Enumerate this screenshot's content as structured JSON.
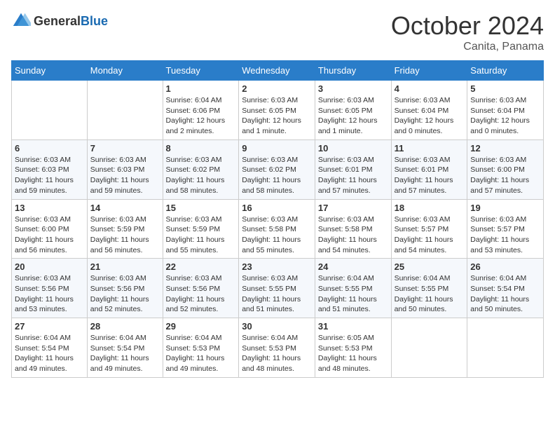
{
  "logo": {
    "text_general": "General",
    "text_blue": "Blue"
  },
  "title": "October 2024",
  "location": "Canita, Panama",
  "days_of_week": [
    "Sunday",
    "Monday",
    "Tuesday",
    "Wednesday",
    "Thursday",
    "Friday",
    "Saturday"
  ],
  "weeks": [
    [
      {
        "day": "",
        "info": ""
      },
      {
        "day": "",
        "info": ""
      },
      {
        "day": "1",
        "info": "Sunrise: 6:04 AM\nSunset: 6:06 PM\nDaylight: 12 hours\nand 2 minutes."
      },
      {
        "day": "2",
        "info": "Sunrise: 6:03 AM\nSunset: 6:05 PM\nDaylight: 12 hours\nand 1 minute."
      },
      {
        "day": "3",
        "info": "Sunrise: 6:03 AM\nSunset: 6:05 PM\nDaylight: 12 hours\nand 1 minute."
      },
      {
        "day": "4",
        "info": "Sunrise: 6:03 AM\nSunset: 6:04 PM\nDaylight: 12 hours\nand 0 minutes."
      },
      {
        "day": "5",
        "info": "Sunrise: 6:03 AM\nSunset: 6:04 PM\nDaylight: 12 hours\nand 0 minutes."
      }
    ],
    [
      {
        "day": "6",
        "info": "Sunrise: 6:03 AM\nSunset: 6:03 PM\nDaylight: 11 hours\nand 59 minutes."
      },
      {
        "day": "7",
        "info": "Sunrise: 6:03 AM\nSunset: 6:03 PM\nDaylight: 11 hours\nand 59 minutes."
      },
      {
        "day": "8",
        "info": "Sunrise: 6:03 AM\nSunset: 6:02 PM\nDaylight: 11 hours\nand 58 minutes."
      },
      {
        "day": "9",
        "info": "Sunrise: 6:03 AM\nSunset: 6:02 PM\nDaylight: 11 hours\nand 58 minutes."
      },
      {
        "day": "10",
        "info": "Sunrise: 6:03 AM\nSunset: 6:01 PM\nDaylight: 11 hours\nand 57 minutes."
      },
      {
        "day": "11",
        "info": "Sunrise: 6:03 AM\nSunset: 6:01 PM\nDaylight: 11 hours\nand 57 minutes."
      },
      {
        "day": "12",
        "info": "Sunrise: 6:03 AM\nSunset: 6:00 PM\nDaylight: 11 hours\nand 57 minutes."
      }
    ],
    [
      {
        "day": "13",
        "info": "Sunrise: 6:03 AM\nSunset: 6:00 PM\nDaylight: 11 hours\nand 56 minutes."
      },
      {
        "day": "14",
        "info": "Sunrise: 6:03 AM\nSunset: 5:59 PM\nDaylight: 11 hours\nand 56 minutes."
      },
      {
        "day": "15",
        "info": "Sunrise: 6:03 AM\nSunset: 5:59 PM\nDaylight: 11 hours\nand 55 minutes."
      },
      {
        "day": "16",
        "info": "Sunrise: 6:03 AM\nSunset: 5:58 PM\nDaylight: 11 hours\nand 55 minutes."
      },
      {
        "day": "17",
        "info": "Sunrise: 6:03 AM\nSunset: 5:58 PM\nDaylight: 11 hours\nand 54 minutes."
      },
      {
        "day": "18",
        "info": "Sunrise: 6:03 AM\nSunset: 5:57 PM\nDaylight: 11 hours\nand 54 minutes."
      },
      {
        "day": "19",
        "info": "Sunrise: 6:03 AM\nSunset: 5:57 PM\nDaylight: 11 hours\nand 53 minutes."
      }
    ],
    [
      {
        "day": "20",
        "info": "Sunrise: 6:03 AM\nSunset: 5:56 PM\nDaylight: 11 hours\nand 53 minutes."
      },
      {
        "day": "21",
        "info": "Sunrise: 6:03 AM\nSunset: 5:56 PM\nDaylight: 11 hours\nand 52 minutes."
      },
      {
        "day": "22",
        "info": "Sunrise: 6:03 AM\nSunset: 5:56 PM\nDaylight: 11 hours\nand 52 minutes."
      },
      {
        "day": "23",
        "info": "Sunrise: 6:03 AM\nSunset: 5:55 PM\nDaylight: 11 hours\nand 51 minutes."
      },
      {
        "day": "24",
        "info": "Sunrise: 6:04 AM\nSunset: 5:55 PM\nDaylight: 11 hours\nand 51 minutes."
      },
      {
        "day": "25",
        "info": "Sunrise: 6:04 AM\nSunset: 5:55 PM\nDaylight: 11 hours\nand 50 minutes."
      },
      {
        "day": "26",
        "info": "Sunrise: 6:04 AM\nSunset: 5:54 PM\nDaylight: 11 hours\nand 50 minutes."
      }
    ],
    [
      {
        "day": "27",
        "info": "Sunrise: 6:04 AM\nSunset: 5:54 PM\nDaylight: 11 hours\nand 49 minutes."
      },
      {
        "day": "28",
        "info": "Sunrise: 6:04 AM\nSunset: 5:54 PM\nDaylight: 11 hours\nand 49 minutes."
      },
      {
        "day": "29",
        "info": "Sunrise: 6:04 AM\nSunset: 5:53 PM\nDaylight: 11 hours\nand 49 minutes."
      },
      {
        "day": "30",
        "info": "Sunrise: 6:04 AM\nSunset: 5:53 PM\nDaylight: 11 hours\nand 48 minutes."
      },
      {
        "day": "31",
        "info": "Sunrise: 6:05 AM\nSunset: 5:53 PM\nDaylight: 11 hours\nand 48 minutes."
      },
      {
        "day": "",
        "info": ""
      },
      {
        "day": "",
        "info": ""
      }
    ]
  ]
}
